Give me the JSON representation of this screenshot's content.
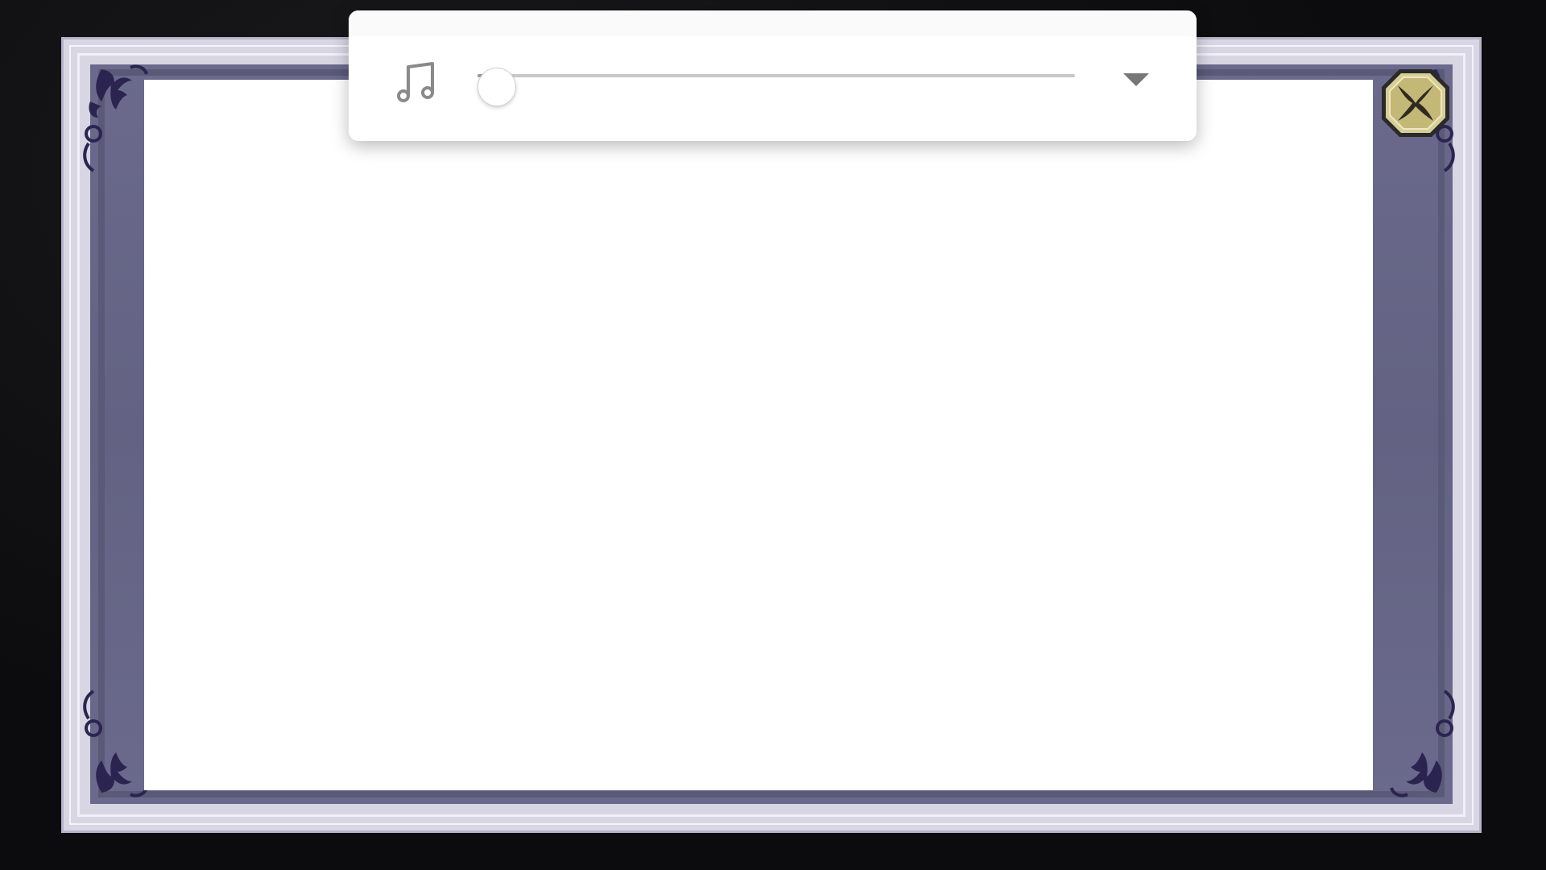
{
  "game_screen": {
    "frame": {
      "style": "parchment-frame",
      "accent_color": "#6b6a8c",
      "border_color": "#d9d6e4",
      "panel_color": "#ffffff"
    },
    "close_button": {
      "icon": "close-icon",
      "color": "#c9bf8a"
    },
    "corner_ornaments": {
      "icon": "fleur-de-lis-icon",
      "color": "#2b2450"
    }
  },
  "music_player": {
    "icon": "music-note-icon",
    "volume_level": 0.0,
    "dropdown_icon": "chevron-down-icon"
  }
}
